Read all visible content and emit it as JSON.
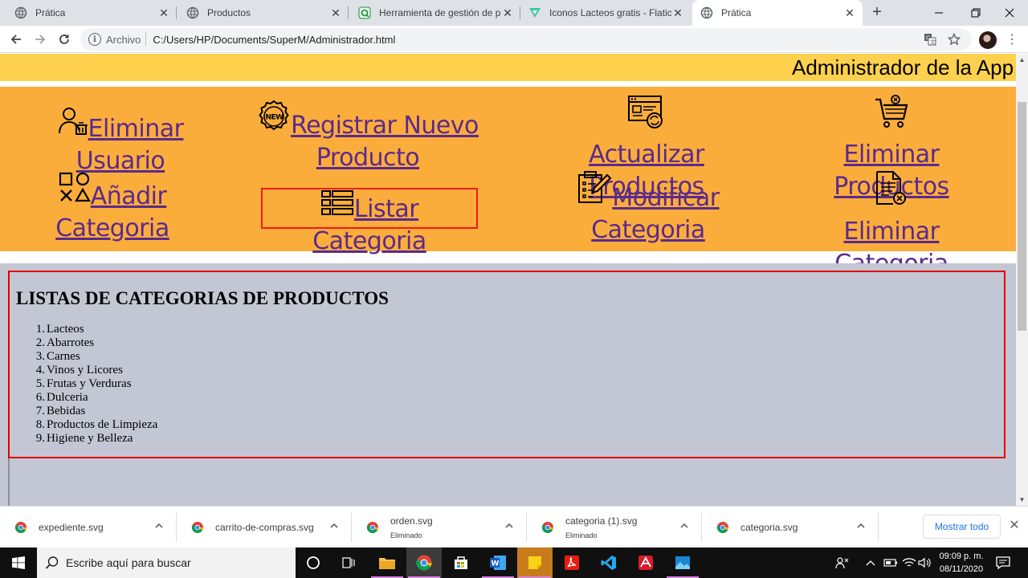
{
  "tabs": [
    {
      "title": "Prática",
      "icon": "globe-icon"
    },
    {
      "title": "Productos",
      "icon": "globe-icon"
    },
    {
      "title": "Herramienta de gestión de pro",
      "icon": "tool-site-icon"
    },
    {
      "title": "Iconos Lacteos gratis - Flaticon",
      "icon": "flaticon-icon"
    },
    {
      "title": "Prática",
      "icon": "globe-icon",
      "active": true
    }
  ],
  "address": {
    "scheme": "Archivo",
    "url": "C:/Users/HP/Documents/SuperM/Administrador.html"
  },
  "page": {
    "banner": "Administrador de la App",
    "nav": [
      {
        "line1": "Eliminar",
        "line2": "Usuario",
        "icon": "user-delete-icon"
      },
      {
        "line1": "Registrar Nuevo",
        "line2": "Producto",
        "icon": "new-badge-icon"
      },
      {
        "line1": "Actualizar",
        "line2": "Productos",
        "icon": "browser-refresh-icon"
      },
      {
        "line1": "Eliminar",
        "line2": "Productos",
        "icon": "shopping-cart-icon"
      },
      {
        "line1": "Añadir",
        "line2": "Categoria",
        "icon": "shapes-icon"
      },
      {
        "line1": "Listar Categoria",
        "line2": "",
        "icon": "list-icon"
      },
      {
        "line1": "Modificar",
        "line2": "Categoria",
        "icon": "clipboard-edit-icon"
      },
      {
        "line1": "Eliminar",
        "line2": "Categoria",
        "icon": "document-delete-icon"
      }
    ],
    "panel": {
      "heading": "LISTAS DE CATEGORIAS DE PRODUCTOS",
      "items": [
        "Lacteos",
        "Abarrotes",
        "Carnes",
        "Vinos y Licores",
        "Frutas y Verduras",
        "Dulceria",
        "Bebidas",
        "Productos de Limpieza",
        "Higiene y Belleza"
      ]
    }
  },
  "downloads": [
    {
      "name": "expediente.svg",
      "status": ""
    },
    {
      "name": "carrito-de-compras.svg",
      "status": ""
    },
    {
      "name": "orden.svg",
      "status": "Eliminado"
    },
    {
      "name": "categoria (1).svg",
      "status": "Eliminado"
    },
    {
      "name": "categoria.svg",
      "status": ""
    }
  ],
  "show_all": "Mostrar todo",
  "taskbar": {
    "search_placeholder": "Escribe aquí para buscar",
    "time": "09:09 p. m.",
    "date": "08/11/2020"
  },
  "colors": {
    "banner": "#fdd14d",
    "nav": "#fbad3c",
    "link": "#5b2a8c",
    "panel": "#c3c7d3",
    "highlight_border": "#ee1c1c"
  }
}
